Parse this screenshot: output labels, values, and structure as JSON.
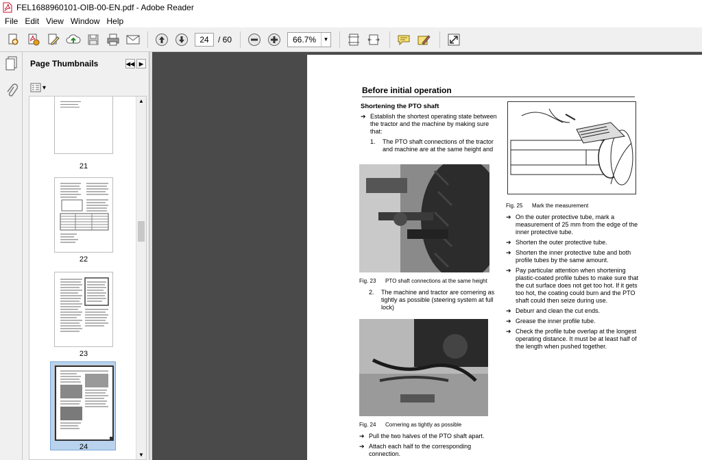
{
  "window": {
    "title": "FEL1688960101-OIB-00-EN.pdf - Adobe Reader"
  },
  "menu": [
    "File",
    "Edit",
    "View",
    "Window",
    "Help"
  ],
  "toolbar": {
    "current_page": "24",
    "total_pages": "/ 60",
    "zoom": "66.7%"
  },
  "sidebar": {
    "title": "Page Thumbnails",
    "thumbnails": [
      {
        "label": "21"
      },
      {
        "label": "22"
      },
      {
        "label": "23"
      },
      {
        "label": "24",
        "selected": true
      }
    ]
  },
  "document": {
    "heading": "Before initial operation",
    "left_column": {
      "subheading": "Shortening the PTO shaft",
      "intro": "Establish the shortest operating state between the tractor and the machine by making sure that:",
      "item1_num": "1.",
      "item1": "The PTO shaft connections of the tractor and machine are at the same height and",
      "fig23_num": "Fig. 23",
      "fig23": "PTO shaft connections at the same height",
      "item2_num": "2.",
      "item2": "The machine and tractor are cornering as tightly as possible (steering system at full lock)",
      "fig24_num": "Fig. 24",
      "fig24": "Cornering as tightly as possible",
      "step_pull": "Pull the two halves of the PTO shaft apart.",
      "step_attach": "Attach each half to the corresponding connection."
    },
    "right_column": {
      "fig25_num": "Fig. 25",
      "fig25": "Mark the measurement",
      "steps": [
        "On the outer protective tube, mark a measurement of 25 mm from the edge of the inner protective tube.",
        "Shorten the outer protective tube.",
        "Shorten the inner protective tube and both profile tubes by the same amount.",
        "Pay particular attention when shortening plastic-coated profile tubes to make sure that the cut surface does not get too hot. If it gets too hot, the coating could burn and the PTO shaft could then seize during use.",
        "Deburr and clean the cut ends.",
        "Grease the inner profile tube.",
        "Check the profile tube overlap at the longest operating distance. It must be at least half of the length when pushed together."
      ]
    }
  },
  "colors": {
    "doc_background": "#4a4a4a",
    "selected_thumb": "#b9d3ee",
    "pdf_icon": "#c8102e"
  }
}
